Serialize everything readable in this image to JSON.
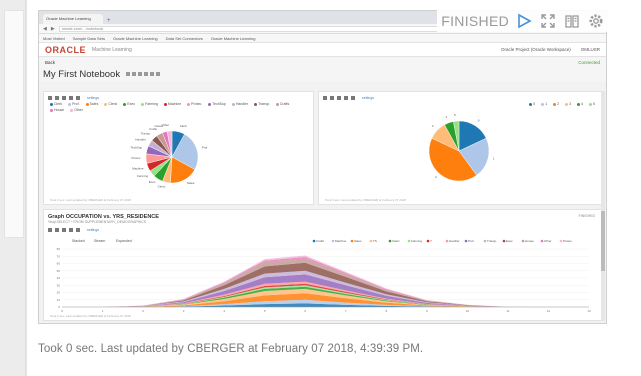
{
  "status": {
    "label": "FINISHED",
    "icons": [
      "run-icon",
      "expand-icon",
      "book-icon",
      "gear-icon"
    ]
  },
  "footer": "Took 0 sec. Last updated by CBERGER at February 07 2018, 4:39:39 PM.",
  "screenshot": {
    "browser_tab": "Oracle Machine Learning",
    "url": "oracle.com/.../notebook",
    "bookmarks": [
      "Most Visited",
      "Sample Data Sets",
      "Oracle Machine Learning",
      "Data Set Connectors",
      "Oracle Machine Learning"
    ],
    "app": {
      "logo": "ORACLE",
      "subtitle": "Machine Learning",
      "project": "Oracle Project (Oracle Workspace)",
      "user": "OMLUSR"
    },
    "back": "Back",
    "connected": "Connected",
    "notebook_title": "My First Notebook",
    "paragraph1": {
      "settings": "settings",
      "legend": [
        {
          "name": "Clerk",
          "color": "#1f77b4"
        },
        {
          "name": "Prof.",
          "color": "#aec7e8"
        },
        {
          "name": "Sales",
          "color": "#ff7f0e"
        },
        {
          "name": "Cleric",
          "color": "#ffbb78"
        },
        {
          "name": "Exec",
          "color": "#2ca02c"
        },
        {
          "name": "Farming",
          "color": "#98df8a"
        },
        {
          "name": "Machine",
          "color": "#d62728"
        },
        {
          "name": "Protec.",
          "color": "#ff9896"
        },
        {
          "name": "TechSup",
          "color": "#9467bd"
        },
        {
          "name": "Handler",
          "color": "#c5b0d5"
        },
        {
          "name": "Transp.",
          "color": "#8c564b"
        },
        {
          "name": "Crafts",
          "color": "#c49c94"
        },
        {
          "name": "House",
          "color": "#e377c2"
        },
        {
          "name": "Other",
          "color": "#f7b6d2"
        }
      ],
      "slices": [
        0.08,
        0.25,
        0.18,
        0.05,
        0.06,
        0.04,
        0.05,
        0.06,
        0.05,
        0.04,
        0.04,
        0.04,
        0.03,
        0.03
      ],
      "footnote": "Took 0 sec. Last updated by CBERGER at February 07 2018"
    },
    "paragraph2": {
      "settings": "settings",
      "legend": [
        {
          "name": "0",
          "color": "#1f77b4"
        },
        {
          "name": "1",
          "color": "#aec7e8"
        },
        {
          "name": "2",
          "color": "#ff7f0e"
        },
        {
          "name": "3",
          "color": "#ffbb78"
        },
        {
          "name": "4",
          "color": "#2ca02c"
        },
        {
          "name": "5",
          "color": "#98df8a"
        }
      ],
      "slices": [
        0.18,
        0.22,
        0.42,
        0.1,
        0.05,
        0.03
      ],
      "footnote": "Took 0 sec. Last updated by CBERGER at February 07 2018"
    },
    "paragraph3": {
      "title": "Graph OCCUPATION vs. YRS_RESIDENCE",
      "subtitle": "%sql SELECT * FROM SUPPLEMENTARY_DEMOGRAPHICS",
      "finished": "FINISHED",
      "settings": "settings",
      "modes": [
        "Stacked",
        "Stream",
        "Expanded"
      ],
      "footnote": "Took 0 sec. Last updated by CBERGER at February 07 2018"
    }
  },
  "chart_data": {
    "type": "area",
    "stacked": true,
    "x": [
      0,
      1,
      2,
      3,
      4,
      5,
      6,
      7,
      8,
      9,
      10,
      11,
      12,
      13
    ],
    "ylim": [
      0,
      80
    ],
    "legend_position": "top-right",
    "series": [
      {
        "name": "Crafts",
        "color": "#1f77b4",
        "values": [
          0,
          0,
          0,
          0.5,
          2,
          4,
          5,
          3,
          1.5,
          0.5,
          0.2,
          0,
          0,
          0
        ]
      },
      {
        "name": "Machine",
        "color": "#aec7e8",
        "values": [
          0,
          0,
          0,
          0.5,
          2,
          4,
          5,
          3,
          1.5,
          0.5,
          0.2,
          0,
          0,
          0
        ]
      },
      {
        "name": "Sales",
        "color": "#ff7f0e",
        "values": [
          0,
          0,
          0.2,
          1.2,
          4,
          8,
          9,
          6,
          3,
          1,
          0.4,
          0,
          0,
          0
        ]
      },
      {
        "name": "TS",
        "color": "#ffbb78",
        "values": [
          0,
          0,
          0.2,
          1,
          3,
          6,
          6,
          4,
          2,
          0.8,
          0.2,
          0,
          0,
          0
        ]
      },
      {
        "name": "Cleric",
        "color": "#2ca02c",
        "values": [
          0,
          0,
          0.1,
          0.5,
          2,
          3,
          3,
          2,
          1,
          0.4,
          0.1,
          0,
          0,
          0
        ]
      },
      {
        "name": "Farming",
        "color": "#98df8a",
        "values": [
          0,
          0,
          0.1,
          0.5,
          1,
          2,
          2,
          1.5,
          0.8,
          0.3,
          0.1,
          0,
          0,
          0
        ]
      },
      {
        "name": "?",
        "color": "#d62728",
        "values": [
          0,
          0,
          0.1,
          0.5,
          1,
          2,
          2,
          1.5,
          0.8,
          0.3,
          0.1,
          0,
          0,
          0
        ]
      },
      {
        "name": "Handler",
        "color": "#ff9896",
        "values": [
          0,
          0,
          0.1,
          0.5,
          2,
          3,
          3,
          2,
          1,
          0.4,
          0.1,
          0,
          0,
          0
        ]
      },
      {
        "name": "Prof.",
        "color": "#9467bd",
        "values": [
          0,
          0,
          0.3,
          1.5,
          5,
          9,
          10,
          7,
          4,
          1.5,
          0.5,
          0.1,
          0,
          0
        ]
      },
      {
        "name": "Transp.",
        "color": "#c5b0d5",
        "values": [
          0,
          0,
          0.2,
          1,
          3,
          5,
          5,
          3.5,
          2,
          0.8,
          0.2,
          0,
          0,
          0
        ]
      },
      {
        "name": "Exec",
        "color": "#8c564b",
        "values": [
          0,
          0,
          0.3,
          1.5,
          5,
          10,
          11,
          8,
          4,
          1.5,
          0.5,
          0.1,
          0,
          0
        ]
      },
      {
        "name": "House",
        "color": "#c49c94",
        "values": [
          0,
          0,
          0.2,
          1,
          3,
          6,
          6,
          4,
          2,
          0.8,
          0.3,
          0,
          0,
          0
        ]
      },
      {
        "name": "Other",
        "color": "#e377c2",
        "values": [
          0,
          0,
          0.1,
          0.5,
          1,
          2,
          2,
          1.5,
          1,
          0.4,
          0.1,
          0,
          0,
          0
        ]
      },
      {
        "name": "Protec.",
        "color": "#f7b6d2",
        "values": [
          0,
          0,
          0.1,
          0.5,
          1,
          2,
          2,
          1.5,
          1,
          0.4,
          0.1,
          0,
          0,
          0
        ]
      }
    ]
  }
}
